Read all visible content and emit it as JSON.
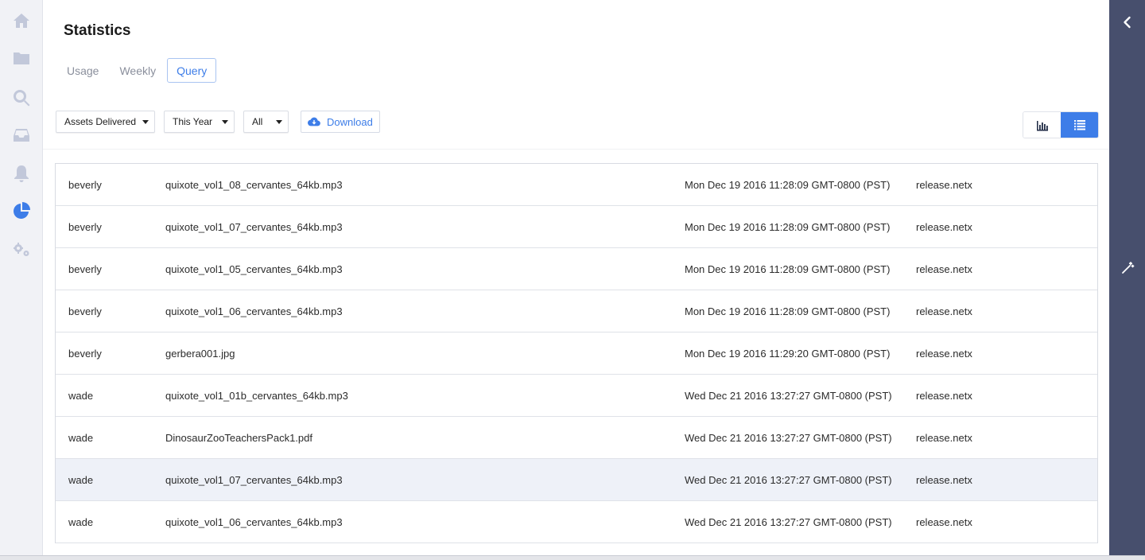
{
  "page": {
    "title": "Statistics"
  },
  "tabs": [
    {
      "label": "Usage",
      "active": false
    },
    {
      "label": "Weekly",
      "active": false
    },
    {
      "label": "Query",
      "active": true
    }
  ],
  "filters": {
    "metric": "Assets Delivered",
    "period": "This Year",
    "scope": "All",
    "download_label": "Download"
  },
  "nav": {
    "items": [
      "home-icon",
      "folder-icon",
      "search-icon",
      "inbox-icon",
      "bell-icon",
      "pie-chart-icon",
      "gears-icon"
    ],
    "active": "pie-chart-icon"
  },
  "rows": [
    {
      "user": "beverly",
      "file": "quixote_vol1_08_cervantes_64kb.mp3",
      "date": "Mon Dec 19 2016 11:28:09 GMT-0800 (PST)",
      "host": "release.netx"
    },
    {
      "user": "beverly",
      "file": "quixote_vol1_07_cervantes_64kb.mp3",
      "date": "Mon Dec 19 2016 11:28:09 GMT-0800 (PST)",
      "host": "release.netx"
    },
    {
      "user": "beverly",
      "file": "quixote_vol1_05_cervantes_64kb.mp3",
      "date": "Mon Dec 19 2016 11:28:09 GMT-0800 (PST)",
      "host": "release.netx"
    },
    {
      "user": "beverly",
      "file": "quixote_vol1_06_cervantes_64kb.mp3",
      "date": "Mon Dec 19 2016 11:28:09 GMT-0800 (PST)",
      "host": "release.netx"
    },
    {
      "user": "beverly",
      "file": "gerbera001.jpg",
      "date": "Mon Dec 19 2016 11:29:20 GMT-0800 (PST)",
      "host": "release.netx"
    },
    {
      "user": "wade",
      "file": "quixote_vol1_01b_cervantes_64kb.mp3",
      "date": "Wed Dec 21 2016 13:27:27 GMT-0800 (PST)",
      "host": "release.netx"
    },
    {
      "user": "wade",
      "file": "DinosaurZooTeachersPack1.pdf",
      "date": "Wed Dec 21 2016 13:27:27 GMT-0800 (PST)",
      "host": "release.netx"
    },
    {
      "user": "wade",
      "file": "quixote_vol1_07_cervantes_64kb.mp3",
      "date": "Wed Dec 21 2016 13:27:27 GMT-0800 (PST)",
      "host": "release.netx"
    },
    {
      "user": "wade",
      "file": "quixote_vol1_06_cervantes_64kb.mp3",
      "date": "Wed Dec 21 2016 13:27:27 GMT-0800 (PST)",
      "host": "release.netx"
    }
  ],
  "colors": {
    "accent": "#3d7de8",
    "rail": "#474f6d",
    "nav_icon": "#c2c8da"
  }
}
